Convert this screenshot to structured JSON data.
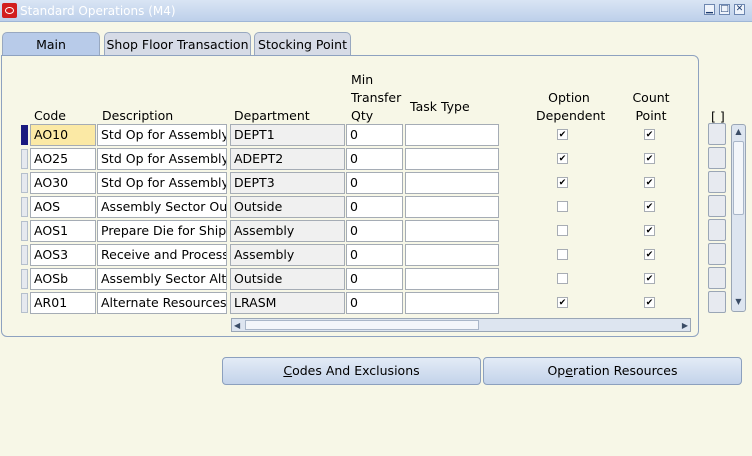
{
  "window": {
    "title": "Standard Operations (M4)",
    "minimize": "▁",
    "maximize": "□",
    "close": "✕"
  },
  "tabs": [
    {
      "label": "Main"
    },
    {
      "label": "Shop Floor Transaction"
    },
    {
      "label": "Stocking Point"
    }
  ],
  "table": {
    "headers": {
      "code": "Code",
      "description": "Description",
      "department": "Department",
      "min_transfer_1": "Min",
      "min_transfer_2": "Transfer",
      "min_transfer_3": "Qty",
      "task_type": "Task Type",
      "option_dependent_1": "Option",
      "option_dependent_2": "Dependent",
      "count_point_1": "Count",
      "count_point_2": "Point",
      "bracket": "[ ]"
    },
    "rows": [
      {
        "code": "AO10",
        "description": "Std Op for AssemblyA",
        "department": "DEPT1",
        "min_transfer_qty": "0",
        "task_type": "",
        "option_dependent": true,
        "count_point": true
      },
      {
        "code": "AO25",
        "description": "Std Op for AssemblyA",
        "department": "ADEPT2",
        "min_transfer_qty": "0",
        "task_type": "",
        "option_dependent": true,
        "count_point": true
      },
      {
        "code": "AO30",
        "description": "Std Op for AssemblyA",
        "department": "DEPT3",
        "min_transfer_qty": "0",
        "task_type": "",
        "option_dependent": true,
        "count_point": true
      },
      {
        "code": "AOS",
        "description": "Assembly Sector Out",
        "department": "Outside",
        "min_transfer_qty": "0",
        "task_type": "",
        "option_dependent": false,
        "count_point": true
      },
      {
        "code": "AOS1",
        "description": "Prepare Die for Shipm",
        "department": "Assembly",
        "min_transfer_qty": "0",
        "task_type": "",
        "option_dependent": false,
        "count_point": true
      },
      {
        "code": "AOS3",
        "description": "Receive and Process",
        "department": "Assembly",
        "min_transfer_qty": "0",
        "task_type": "",
        "option_dependent": false,
        "count_point": true
      },
      {
        "code": "AOSb",
        "description": "Assembly Sector Alte",
        "department": "Outside",
        "min_transfer_qty": "0",
        "task_type": "",
        "option_dependent": false,
        "count_point": true
      },
      {
        "code": "AR01",
        "description": "Alternate Resources C",
        "department": "LRASM",
        "min_transfer_qty": "0",
        "task_type": "",
        "option_dependent": true,
        "count_point": true
      }
    ]
  },
  "buttons": {
    "codes_mnemonic": "C",
    "codes_rest": "odes And Exclusions",
    "resources_pre": "Op",
    "resources_mnemonic": "e",
    "resources_rest": "ration Resources"
  },
  "colors": {
    "title_text": "#ffffff",
    "focus_field": "#fbe9a5",
    "row_indicator": "#1a1a80"
  }
}
